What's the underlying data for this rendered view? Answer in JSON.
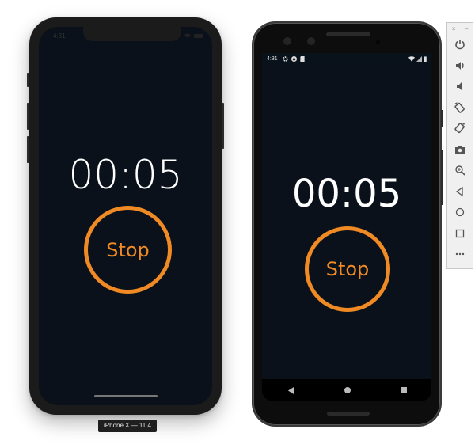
{
  "ios_simulator": {
    "device_label": "iPhone X — 11.4",
    "status_time": "4:31",
    "timer": "00:05",
    "stop_button_label": "Stop"
  },
  "android_emulator": {
    "status_time": "4:31",
    "status_icons": [
      "gear-icon",
      "a-circle-icon",
      "sd-card-icon"
    ],
    "status_right_icons": [
      "wifi-icon",
      "signal-icon",
      "battery-icon"
    ],
    "timer": "00:05",
    "stop_button_label": "Stop",
    "nav_buttons": [
      "back-icon",
      "home-icon",
      "recents-icon"
    ]
  },
  "emulator_toolbar": {
    "close_label": "×",
    "minimize_label": "–",
    "tools": [
      "power",
      "volume-up",
      "volume-down",
      "rotate-left",
      "rotate-right",
      "screenshot",
      "zoom",
      "back",
      "home",
      "overview",
      "more"
    ]
  },
  "colors": {
    "accent": "#f08a24",
    "screen_bg": "#0a111a",
    "timer_text": "#ffffff"
  }
}
